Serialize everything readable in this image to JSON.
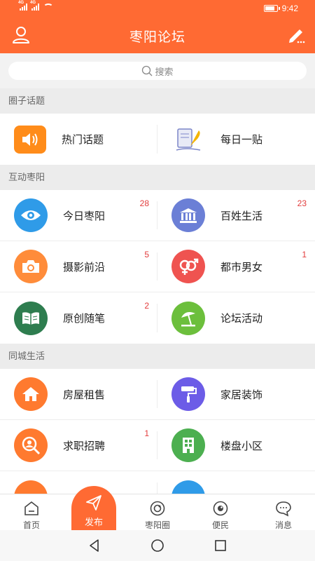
{
  "status_bar": {
    "time": "9:42",
    "signal1": "4G",
    "signal2": "4G",
    "battery_level": 0.85
  },
  "header": {
    "title": "枣阳论坛",
    "left_icon": "user-icon",
    "right_icon": "edit-icon"
  },
  "search": {
    "placeholder": "搜索"
  },
  "sections": [
    {
      "label": "圈子话题",
      "items": [
        {
          "label": "热门话题",
          "icon": "speaker-icon",
          "color": "#ff8c1a",
          "badge": ""
        },
        {
          "label": "每日一贴",
          "icon": "paper-quill-icon",
          "color": "#e8eaf6",
          "badge": ""
        }
      ]
    },
    {
      "label": "互动枣阳",
      "items": [
        {
          "label": "今日枣阳",
          "icon": "eye-icon",
          "color": "#2f9be8",
          "badge": "28"
        },
        {
          "label": "百姓生活",
          "icon": "building-icon",
          "color": "#6b7fd6",
          "badge": "23"
        },
        {
          "label": "摄影前沿",
          "icon": "camera-icon",
          "color": "#ff8c3a",
          "badge": "5"
        },
        {
          "label": "都市男女",
          "icon": "gender-icon",
          "color": "#ef5350",
          "badge": "1"
        },
        {
          "label": "原创随笔",
          "icon": "book-icon",
          "color": "#2e7d4f",
          "badge": "2"
        },
        {
          "label": "论坛活动",
          "icon": "umbrella-icon",
          "color": "#6cbf3c",
          "badge": ""
        }
      ]
    },
    {
      "label": "同城生活",
      "items": [
        {
          "label": "房屋租售",
          "icon": "house-icon",
          "color": "#ff7a2f",
          "badge": ""
        },
        {
          "label": "家居装饰",
          "icon": "paint-roller-icon",
          "color": "#6c5ce7",
          "badge": ""
        },
        {
          "label": "求职招聘",
          "icon": "search-person-icon",
          "color": "#ff7a2f",
          "badge": "1"
        },
        {
          "label": "楼盘小区",
          "icon": "apartment-icon",
          "color": "#4caf50",
          "badge": ""
        },
        {
          "label": "",
          "icon": "car-icon",
          "color": "#ff7a2f",
          "badge": ""
        },
        {
          "label": "",
          "icon": "cart-icon",
          "color": "#2f9be8",
          "badge": ""
        }
      ]
    }
  ],
  "tabbar": {
    "tabs": [
      {
        "label": "首页",
        "icon": "home-icon"
      },
      {
        "label": "发布",
        "icon": "send-icon"
      },
      {
        "label": "枣阳圈",
        "icon": "circle-icon"
      },
      {
        "label": "便民",
        "icon": "convenience-icon"
      },
      {
        "label": "消息",
        "icon": "message-icon"
      }
    ],
    "active_color": "#ff6a33"
  },
  "colors": {
    "brand": "#ff6a33",
    "badge": "#e23c3c"
  }
}
